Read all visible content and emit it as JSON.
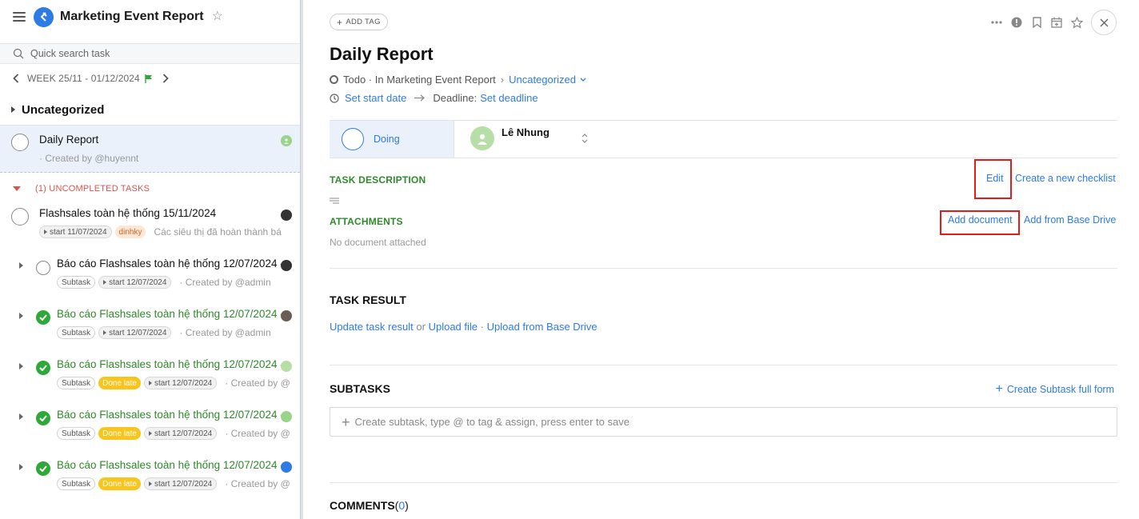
{
  "sidebar": {
    "app_title": "Marketing Event Report",
    "search_placeholder": "Quick search task",
    "week_label": "WEEK 25/11 - 01/12/2024",
    "group_title": "Uncategorized",
    "selected_task": {
      "name": "Daily Report",
      "created_by": "· Created by @huyennt"
    },
    "uncompleted_label": "(1) UNCOMPLETED TASKS",
    "tasks": [
      {
        "name": "Flashsales toàn hệ thống 15/11/2024",
        "chips": [
          "start 11/07/2024",
          "dinhky"
        ],
        "note": "Các siêu thị đã hoàn thành bá",
        "done": false
      },
      {
        "name": "Báo cáo Flashsales toàn hệ thống 12/07/2024 -",
        "chips": [
          "Subtask",
          "start 12/07/2024"
        ],
        "note": "· Created by @admin",
        "done": false
      },
      {
        "name": "Báo cáo Flashsales toàn hệ thống 12/07/2024 -",
        "chips": [
          "Subtask",
          "start 12/07/2024"
        ],
        "note": "· Created by @admin",
        "done": true
      },
      {
        "name": "Báo cáo Flashsales toàn hệ thống 12/07/2024 -",
        "chips": [
          "Subtask",
          "Done late",
          "start 12/07/2024"
        ],
        "note": "· Created by @",
        "done": true
      },
      {
        "name": "Báo cáo Flashsales toàn hệ thống 12/07/2024 -",
        "chips": [
          "Subtask",
          "Done late",
          "start 12/07/2024"
        ],
        "note": "· Created by @",
        "done": true
      },
      {
        "name": "Báo cáo Flashsales toàn hệ thống 12/07/2024 -",
        "chips": [
          "Subtask",
          "Done late",
          "start 12/07/2024"
        ],
        "note": "· Created by @",
        "done": true
      }
    ]
  },
  "detail": {
    "add_tag_label": "ADD TAG",
    "title": "Daily Report",
    "status_text": "Todo · In Marketing Event Report",
    "category": "Uncategorized",
    "set_start_date": "Set start date",
    "deadline_label": "Deadline:",
    "set_deadline": "Set deadline",
    "stage": "Doing",
    "assignee": "Lê Nhung",
    "task_description_label": "TASK DESCRIPTION",
    "edit_label": "Edit",
    "create_checklist_label": "Create a new checklist",
    "attachments_label": "ATTACHMENTS",
    "add_document_label": "Add document",
    "add_from_drive_label": "Add from Base Drive",
    "no_document_text": "No document attached",
    "task_result_title": "TASK RESULT",
    "update_result_label": "Update task result",
    "or_text": "or",
    "upload_file_label": "Upload file",
    "dot_sep": "·",
    "upload_from_drive_label": "Upload from Base Drive",
    "subtasks_title": "SUBTASKS",
    "create_subtask_full_label": "Create Subtask full form",
    "subtask_placeholder": "Create subtask, type @ to tag & assign, press enter to save",
    "comments_title": "COMMENTS",
    "comments_count_open": "(",
    "comments_count": "0",
    "comments_count_close": ")"
  },
  "colors": {
    "accent": "#2d7be4",
    "success": "#2f8a2c",
    "danger": "#d9534f",
    "highlight": "#e31b1b"
  },
  "icons": [
    "menu-icon",
    "app-logo-icon",
    "star-icon",
    "search-icon",
    "chevron-left-icon",
    "chevron-right-icon",
    "flag-icon",
    "more-icon",
    "info-icon",
    "bookmark-icon",
    "calendar-icon",
    "close-icon",
    "clock-icon",
    "arrow-right-icon",
    "sort-icon",
    "plus-icon",
    "lines-icon"
  ]
}
